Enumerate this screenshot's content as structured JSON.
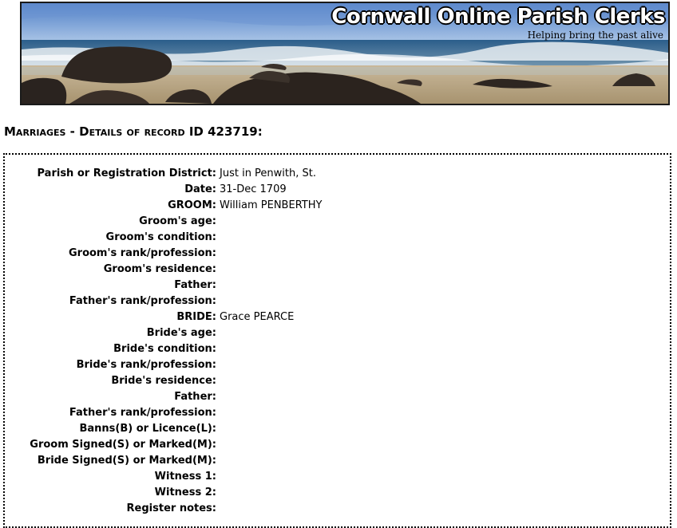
{
  "site": {
    "title": "Cornwall Online Parish Clerks",
    "tagline": "Helping bring the past alive"
  },
  "heading": "Marriages - Details of record ID 423719:",
  "record": [
    {
      "label": "Parish or Registration District:",
      "value": "Just in Penwith, St."
    },
    {
      "label": "Date:",
      "value": "31-Dec 1709"
    },
    {
      "label": "GROOM:",
      "value": "William PENBERTHY"
    },
    {
      "label": "Groom's age:",
      "value": ""
    },
    {
      "label": "Groom's condition:",
      "value": ""
    },
    {
      "label": "Groom's rank/profession:",
      "value": ""
    },
    {
      "label": "Groom's residence:",
      "value": ""
    },
    {
      "label": "Father:",
      "value": ""
    },
    {
      "label": "Father's rank/profession:",
      "value": ""
    },
    {
      "label": "BRIDE:",
      "value": "Grace PEARCE"
    },
    {
      "label": "Bride's age:",
      "value": ""
    },
    {
      "label": "Bride's condition:",
      "value": ""
    },
    {
      "label": "Bride's rank/profession:",
      "value": ""
    },
    {
      "label": "Bride's residence:",
      "value": ""
    },
    {
      "label": "Father:",
      "value": ""
    },
    {
      "label": "Father's rank/profession:",
      "value": ""
    },
    {
      "label": "Banns(B) or Licence(L):",
      "value": ""
    },
    {
      "label": "Groom Signed(S) or Marked(M):",
      "value": ""
    },
    {
      "label": "Bride Signed(S) or Marked(M):",
      "value": ""
    },
    {
      "label": "Witness 1:",
      "value": ""
    },
    {
      "label": "Witness 2:",
      "value": ""
    },
    {
      "label": "Register notes:",
      "value": ""
    }
  ]
}
